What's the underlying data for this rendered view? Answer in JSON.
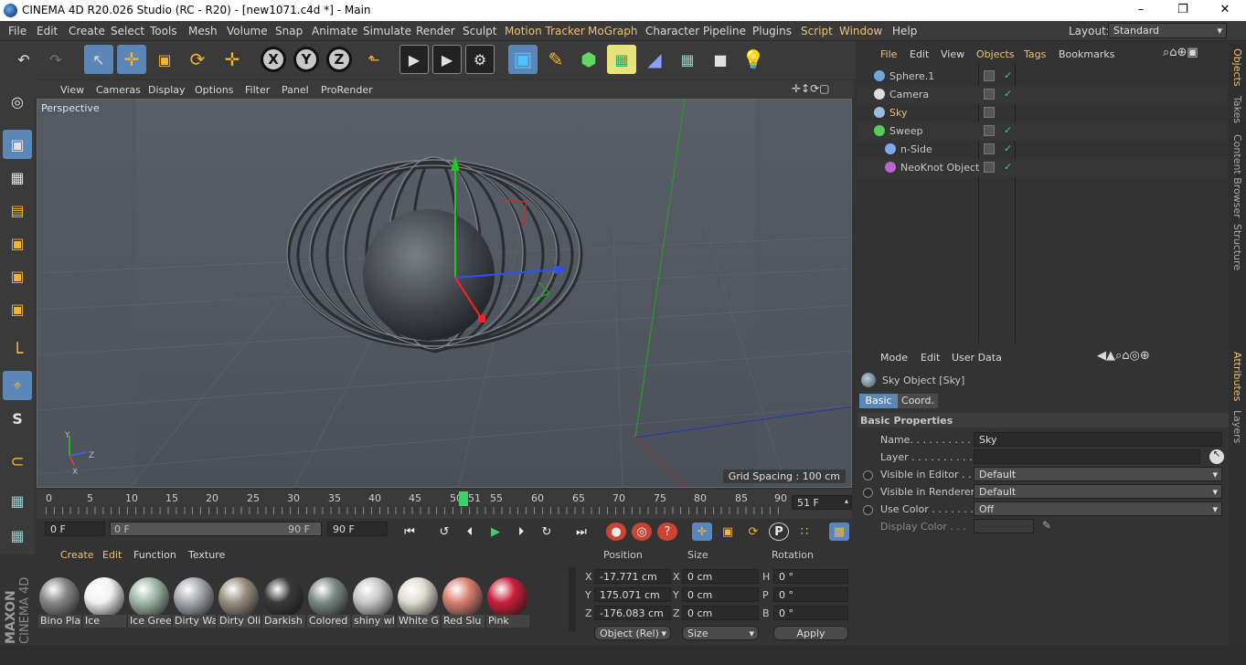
{
  "window": {
    "title": "CINEMA 4D R20.026 Studio (RC - R20) - [new1071.c4d *] - Main"
  },
  "menu": [
    "File",
    "Edit",
    "Create",
    "Select",
    "Tools",
    "Mesh",
    "Volume",
    "Snap",
    "Animate",
    "Simulate",
    "Render",
    "Sculpt",
    "Motion Tracker",
    "MoGraph",
    "Character",
    "Pipeline",
    "Plugins",
    "Script",
    "Window",
    "Help"
  ],
  "layout": {
    "label": "Layout:",
    "value": "Standard"
  },
  "viewport": {
    "menu": [
      "View",
      "Cameras",
      "Display",
      "Options",
      "Filter",
      "Panel",
      "ProRender"
    ],
    "camera_label": "Perspective",
    "grid_spacing": "Grid Spacing : 100 cm"
  },
  "timeline": {
    "ticks": [
      "0",
      "5",
      "10",
      "15",
      "20",
      "25",
      "30",
      "35",
      "40",
      "45",
      "50",
      "51",
      "55",
      "60",
      "65",
      "70",
      "75",
      "80",
      "85",
      "90"
    ],
    "current_frame": "51 F",
    "start_field": "0 F",
    "range_start": "0 F",
    "range_end": "90 F",
    "end_field": "90 F"
  },
  "materials": {
    "menu": [
      "Create",
      "Edit",
      "Function",
      "Texture"
    ],
    "items": [
      {
        "name": "Bino Pla",
        "color": "#888"
      },
      {
        "name": "Ice",
        "color": "#f2f2f2"
      },
      {
        "name": "Ice Gree",
        "color": "#9fb8a8"
      },
      {
        "name": "Dirty Wa",
        "color": "#a8aab0"
      },
      {
        "name": "Dirty Oli",
        "color": "#9a9080"
      },
      {
        "name": "Darkish",
        "color": "#3a3a3c"
      },
      {
        "name": "Colored",
        "color": "#7c8a84"
      },
      {
        "name": "shiny wl",
        "color": "#c8c8c8"
      },
      {
        "name": "White G",
        "color": "#e0dcd0"
      },
      {
        "name": "Red Slu",
        "color": "#d88070"
      },
      {
        "name": "Pink",
        "color": "#c8203a"
      }
    ]
  },
  "coords": {
    "headers": [
      "Position",
      "Size",
      "Rotation"
    ],
    "rows": [
      {
        "axis": "X",
        "pos": "-17.771 cm",
        "size_axis": "X",
        "size": "0 cm",
        "rot_axis": "H",
        "rot": "0 °"
      },
      {
        "axis": "Y",
        "pos": "175.071 cm",
        "size_axis": "Y",
        "size": "0 cm",
        "rot_axis": "P",
        "rot": "0 °"
      },
      {
        "axis": "Z",
        "pos": "-176.083 cm",
        "size_axis": "Z",
        "size": "0 cm",
        "rot_axis": "B",
        "rot": "0 °"
      }
    ],
    "mode": "Object (Rel)",
    "size_mode": "Size",
    "apply": "Apply"
  },
  "objects": {
    "menu": [
      "File",
      "Edit",
      "View",
      "Objects",
      "Tags",
      "Bookmarks"
    ],
    "items": [
      {
        "name": "Sphere.1",
        "indent": 0
      },
      {
        "name": "Camera",
        "indent": 0
      },
      {
        "name": "Sky",
        "indent": 0
      },
      {
        "name": "Sweep",
        "indent": 0
      },
      {
        "name": "n-Side",
        "indent": 1
      },
      {
        "name": "NeoKnot Object",
        "indent": 1
      }
    ]
  },
  "attributes": {
    "menu": [
      "Mode",
      "Edit",
      "User Data"
    ],
    "object_title": "Sky Object [Sky]",
    "tabs": [
      "Basic",
      "Coord."
    ],
    "section": "Basic Properties",
    "props": [
      {
        "label": "Name. . . . . . . . . . . . .",
        "value": "Sky"
      },
      {
        "label": "Layer . . . . . . . . . . . .",
        "value": ""
      },
      {
        "label": "Visible in Editor . .",
        "value": "Default"
      },
      {
        "label": "Visible in Renderer",
        "value": "Default"
      },
      {
        "label": "Use Color . . . . . . . .",
        "value": "Off"
      },
      {
        "label": "Display Color . . .",
        "value": ""
      }
    ]
  },
  "side_tabs_top": [
    "Objects",
    "Takes",
    "Content Browser",
    "Structure"
  ],
  "side_tabs_bottom": [
    "Attributes",
    "Layers"
  ],
  "brand": {
    "line1": "MAXON",
    "line2": "CINEMA 4D"
  }
}
